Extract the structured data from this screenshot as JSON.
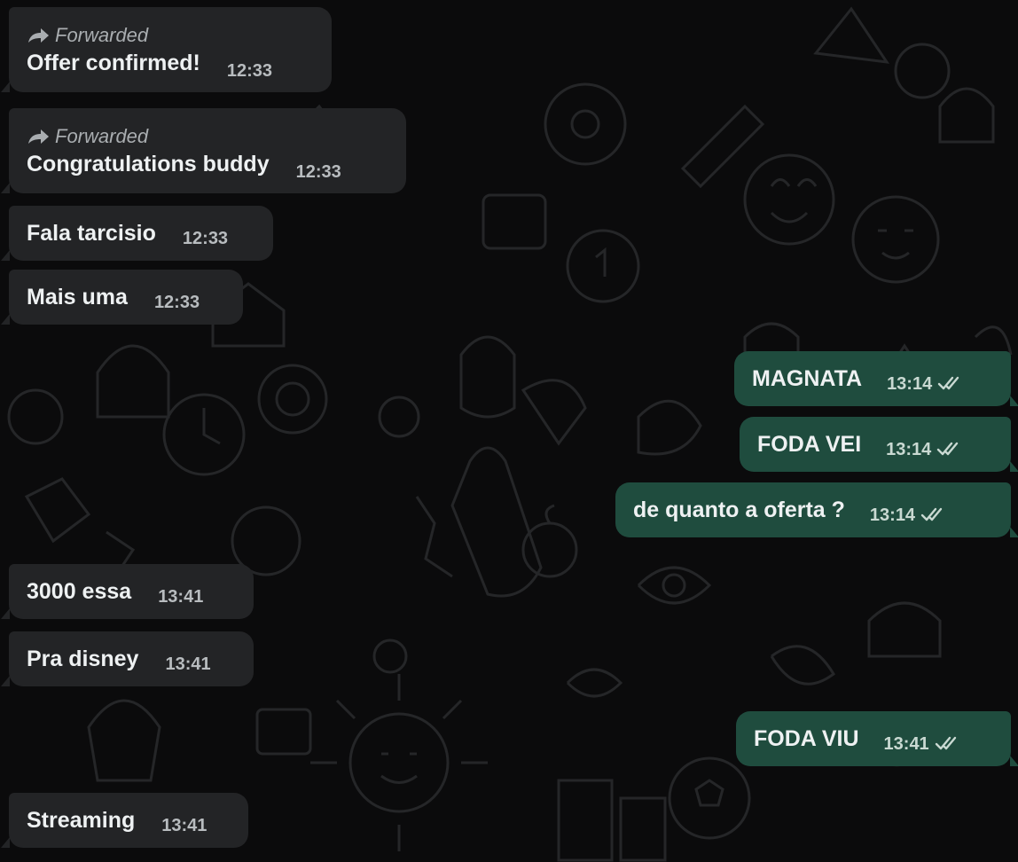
{
  "colors": {
    "background": "#0b0b0c",
    "incoming_bubble": "#232426",
    "outgoing_bubble": "#1f4c3e",
    "text": "#eef1f2",
    "timestamp": "#b8bcbf",
    "forwarded_label": "#a9adb0"
  },
  "forwarded_icon": "forward-arrow-icon",
  "read_icon": "double-check-icon",
  "messages": [
    {
      "direction": "incoming",
      "forwarded_label": "Forwarded",
      "text": "Offer confirmed!",
      "time": "12:33"
    },
    {
      "direction": "incoming",
      "forwarded_label": "Forwarded",
      "text": "Congratulations buddy",
      "time": "12:33"
    },
    {
      "direction": "incoming",
      "text": "Fala tarcisio",
      "time": "12:33"
    },
    {
      "direction": "incoming",
      "text": "Mais uma",
      "time": "12:33"
    },
    {
      "direction": "outgoing",
      "text": "MAGNATA",
      "time": "13:14"
    },
    {
      "direction": "outgoing",
      "text": "FODA VEI",
      "time": "13:14"
    },
    {
      "direction": "outgoing",
      "text": "de quanto a oferta ?",
      "time": "13:14"
    },
    {
      "direction": "incoming",
      "text": "3000 essa",
      "time": "13:41"
    },
    {
      "direction": "incoming",
      "text": "Pra disney",
      "time": "13:41"
    },
    {
      "direction": "outgoing",
      "text": "FODA VIU",
      "time": "13:41"
    },
    {
      "direction": "incoming",
      "text": "Streaming",
      "time": "13:41"
    }
  ]
}
